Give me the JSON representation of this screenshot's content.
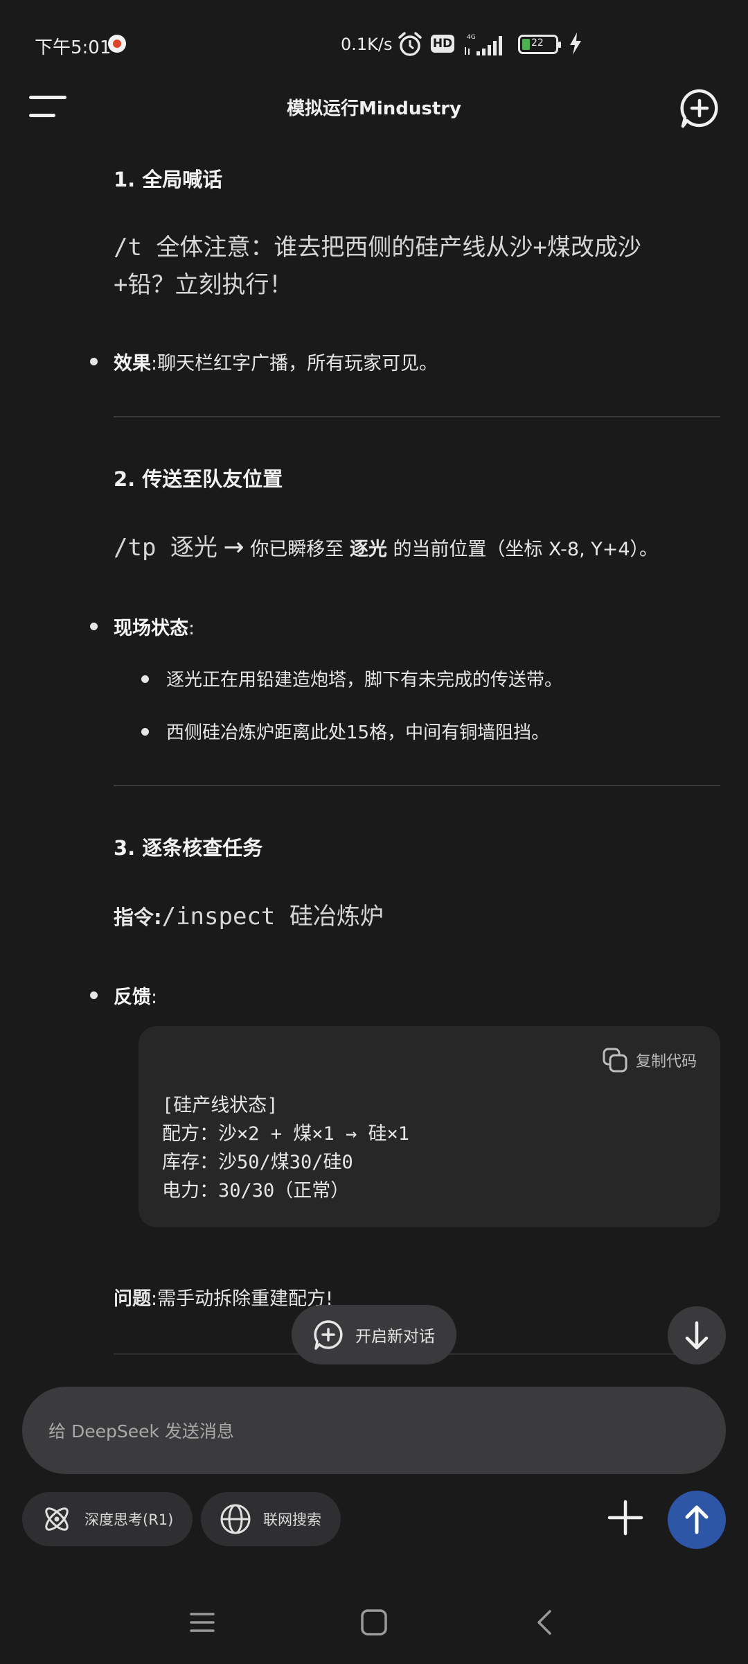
{
  "status_bar": {
    "time": "下午5:01",
    "net_speed": "0.1K/s",
    "hd": "HD",
    "network_type": "4G",
    "battery_level": "22",
    "icons": [
      "notification-icon",
      "alarm-icon",
      "hd-icon",
      "signal-icon",
      "battery-icon",
      "charging-icon"
    ]
  },
  "top_bar": {
    "title": "模拟运行Mindustry",
    "menu_icon": "hamburger-menu-icon",
    "new_chat_icon": "new-chat-icon"
  },
  "content": {
    "section1": {
      "heading": "1. 全局喊话",
      "command": "/t 全体注意：谁去把西侧的硅产线从沙+煤改成沙+铅？立刻执行！",
      "command_line1": "/t 全体注意：谁去把西侧的硅产线从沙+煤改成沙",
      "command_line2": "+铅？立刻执行！",
      "bullet_label": "效果",
      "bullet_text": ":聊天栏红字广播，所有玩家可见。"
    },
    "section2": {
      "heading": "2. 传送至队友位置",
      "command": "/tp 逐光",
      "arrow": "→",
      "desc_pre": "你已瞬移至",
      "desc_bold": "逐光",
      "desc_post": "的当前位置（坐标 X-8, Y+4）。",
      "bullet_label": "现场状态",
      "bullet_colon": ":",
      "sub_bullets": [
        "逐光正在用铅建造炮塔，脚下有未完成的传送带。",
        "西侧硅冶炼炉距离此处15格，中间有铜墙阻挡。"
      ]
    },
    "section3": {
      "heading": "3. 逐条核查任务",
      "cmd_label": "指令:",
      "command": "/inspect 硅冶炼炉",
      "bullet_label": "反馈",
      "bullet_colon": ":",
      "code": {
        "copy_label": "复制代码",
        "lines": [
          "[硅产线状态]",
          "配方：沙×2 + 煤×1 → 硅×1",
          "库存：沙50/煤30/硅0",
          "电力：30/30（正常）"
        ]
      },
      "issue_label": "问题",
      "issue_text": ":需手动拆除重建配方!"
    }
  },
  "floating": {
    "new_dialog_label": "开启新对话",
    "scroll_down_icon": "arrow-down-icon"
  },
  "composer": {
    "placeholder": "给 DeepSeek 发送消息",
    "deep_think_label": "深度思考(R1)",
    "web_search_label": "联网搜索",
    "add_icon": "plus-icon",
    "send_icon": "arrow-up-icon"
  },
  "navbar": {
    "items": [
      "menu-nav-icon",
      "home-nav-icon",
      "back-nav-icon"
    ]
  },
  "colors": {
    "background": "#1a1a1b",
    "accent_send": "#2e56a6",
    "battery_fill": "#4caf50"
  }
}
